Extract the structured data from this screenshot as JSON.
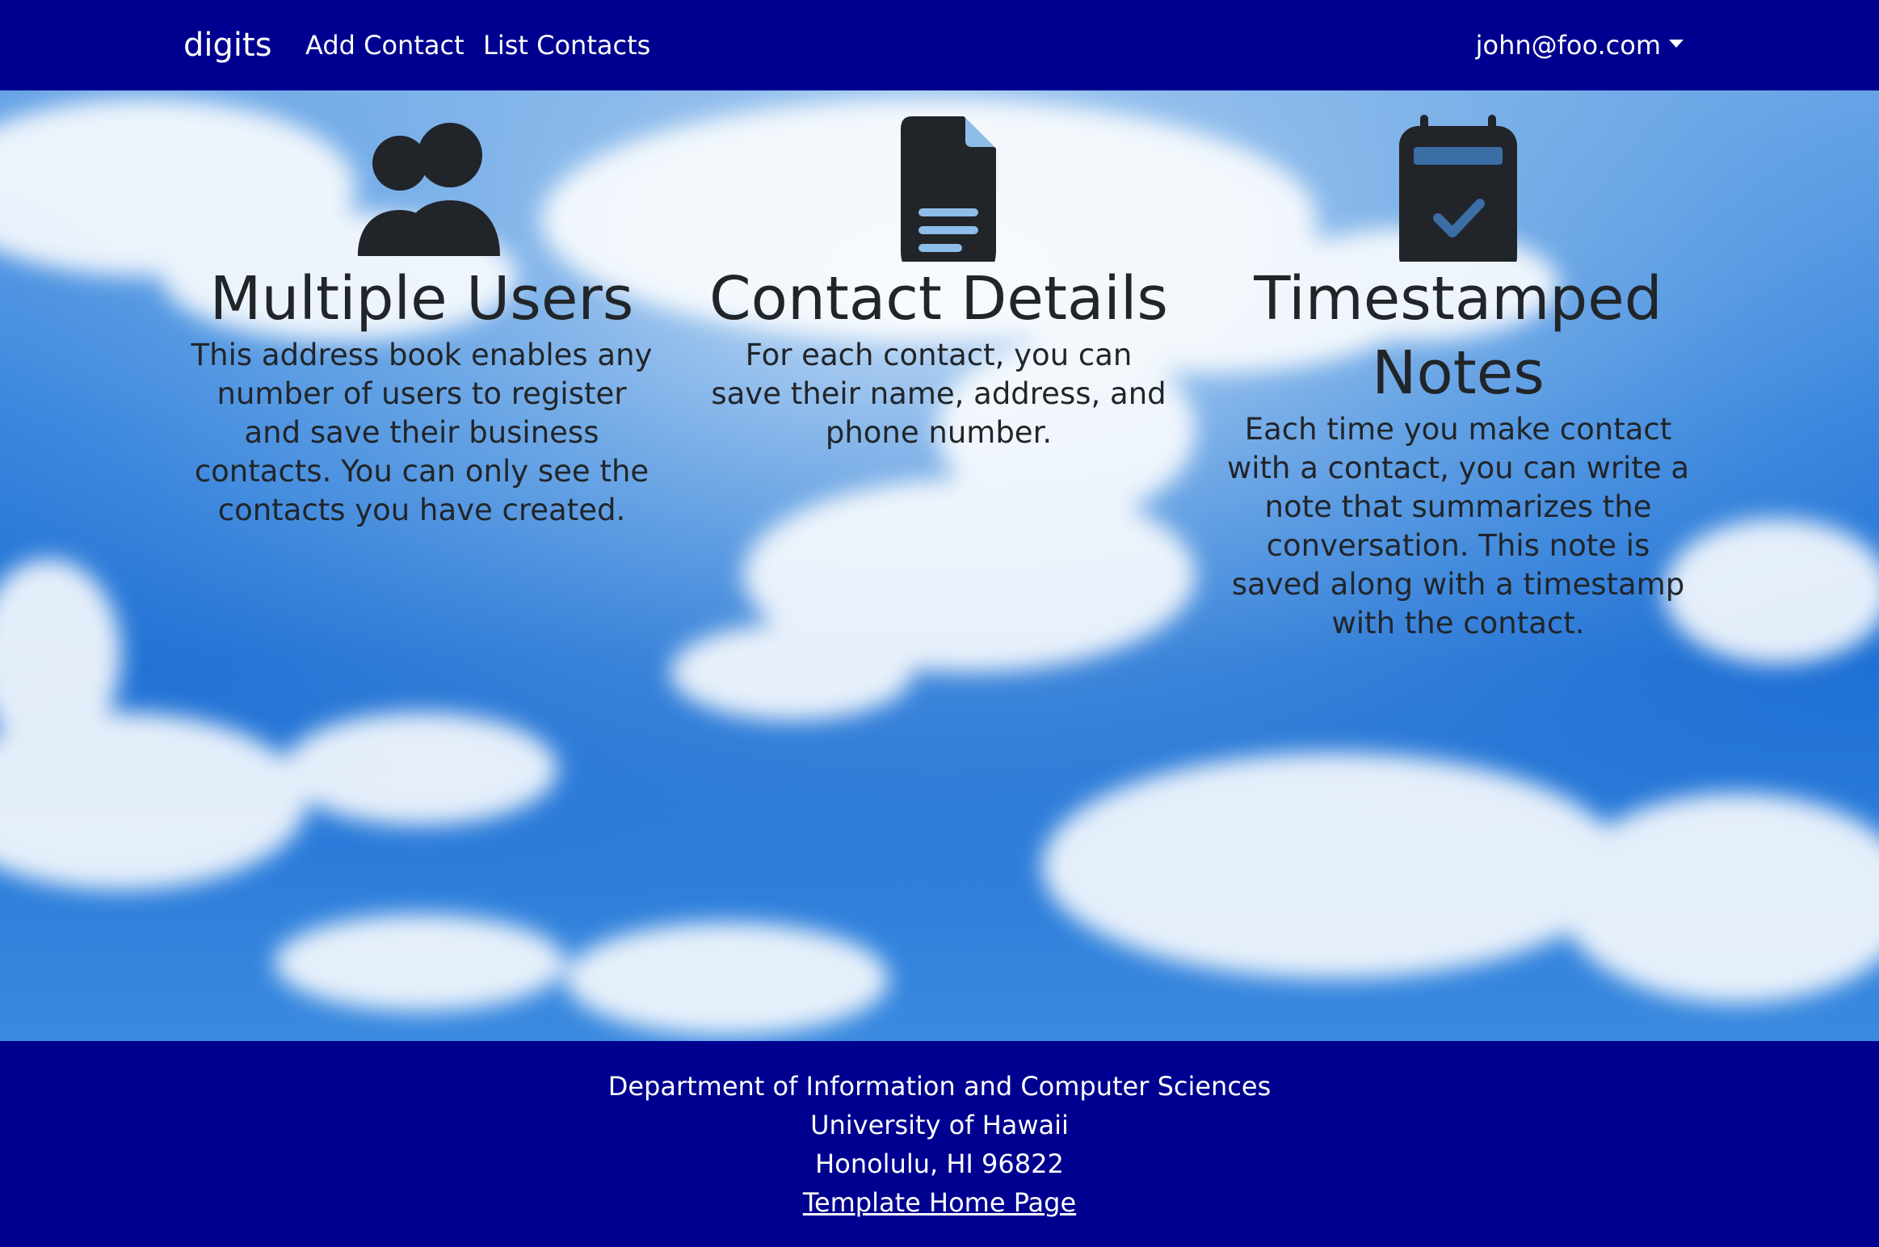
{
  "colors": {
    "navbar_bg": "#000090",
    "footer_bg": "#000090",
    "text_dark": "#212529",
    "text_light": "#ffffff"
  },
  "navbar": {
    "brand": "digits",
    "links": [
      {
        "label": "Add Contact"
      },
      {
        "label": "List Contacts"
      }
    ],
    "user_menu": {
      "label": "john@foo.com",
      "icon": "chevron-down-icon"
    }
  },
  "features": [
    {
      "icon": "users-icon",
      "title": "Multiple Users",
      "text": "This address book enables any number of users to register and save their business contacts. You can only see the contacts you have created."
    },
    {
      "icon": "document-icon",
      "title": "Contact Details",
      "text": "For each contact, you can save their name, address, and phone number."
    },
    {
      "icon": "calendar-check-icon",
      "title": "Timestamped Notes",
      "text": "Each time you make contact with a contact, you can write a note that summarizes the conversation. This note is saved along with a timestamp with the contact."
    }
  ],
  "footer": {
    "line1": "Department of Information and Computer Sciences",
    "line2": "University of Hawaii",
    "line3": "Honolulu, HI 96822",
    "link": "Template Home Page"
  }
}
